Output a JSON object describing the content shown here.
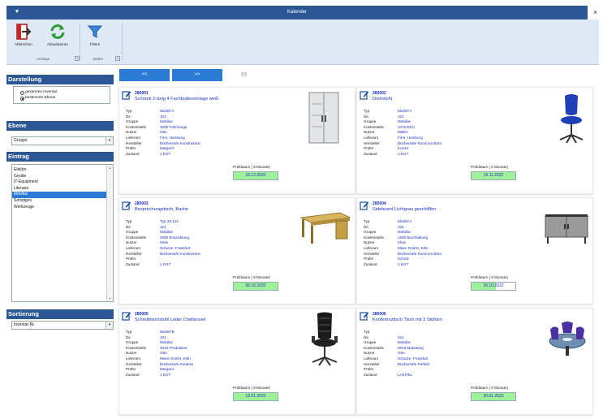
{
  "window": {
    "title": "Kalender",
    "quick_access": "⯆",
    "close": "×"
  },
  "ribbon": {
    "buttons": [
      {
        "label": "Abbrechen",
        "icon": "exit-icon"
      },
      {
        "label": "Aktualisieren",
        "icon": "refresh-icon"
      },
      {
        "label": "Filtern",
        "icon": "filter-icon"
      }
    ],
    "groups": [
      "Anzeige",
      "Daten"
    ]
  },
  "left": {
    "darstellung": {
      "title": "Darstellung",
      "options": [
        "gesamtes Inventar",
        "bestimmte Ebene"
      ],
      "selected": 1
    },
    "ebene": {
      "title": "Ebene",
      "value": "Gruppe"
    },
    "eintrag": {
      "title": "Eintrag",
      "items": [
        "Elektro",
        "Geräte",
        "IT-Equipment",
        "Literatur",
        "Mobiliar",
        "Sonstiges",
        "Werkzeuge"
      ],
      "selected": 4
    },
    "sortierung": {
      "title": "Sortierung",
      "value": "Inventar-Nr."
    }
  },
  "pager": {
    "prev": "<<",
    "next": ">>",
    "info": "1/3"
  },
  "colors": {
    "accent": "#2b5797",
    "button": "#2b7ad6",
    "link": "#1a2fbf",
    "due_fill": "#9ff09a"
  },
  "field_labels": [
    "Typ",
    "Dir.",
    "Gruppe",
    "Kostenstelle",
    "Nutzer",
    "Lieferant",
    "Hersteller",
    "Prüfer",
    "Zustand"
  ],
  "pruef_label": "Prüfdatum ( 6 Monate)",
  "cards": [
    {
      "number": "280001",
      "description": "Schrank 2-türig 4 Fachbodeneinlage weiß",
      "image": "cabinet-image",
      "values": [
        "Modell A",
        "101",
        "Mobiliar",
        "3000 Fahrzeuge",
        "Otto",
        "Firm. Hamburg",
        "Büchersafe Konstruktion",
        "Margerit",
        "1 EGT"
      ],
      "pruefdatum": "16.12.2022",
      "fill": 1.0
    },
    {
      "number": "280002",
      "description": "Drehstuhl",
      "image": "office-chair-image",
      "values": [
        "Modell A",
        "101",
        "Mobiliar",
        "1070 EDV",
        "Müller",
        "Firm. Hamburg",
        "Büchersafe Rund um Büro",
        "Kunze",
        "1 EGT"
      ],
      "pruefdatum": "16.11.2022",
      "fill": 1.0
    },
    {
      "number": "280003",
      "description": "Besprechungstisch, Buche",
      "image": "desk-image",
      "values": [
        "Typ 33-122",
        "101",
        "Mobiliar",
        "2000 Entwicklung",
        "Klein",
        "Schulze, Frankfurt",
        "Büchersafe Konstruktion",
        "",
        "1 EGT"
      ],
      "pruefdatum": "06.10.2022",
      "fill": 1.0
    },
    {
      "number": "280004",
      "description": "Sideboard Lichtgrau geschliffen",
      "image": "sideboard-image",
      "values": [
        "Modell A",
        "101",
        "Mobiliar",
        "1000 Buchhaltung",
        "Klein",
        "Meier GmbH, Köln",
        "Büchersafe Rund um Büro",
        "Scholz",
        "1 EGT"
      ],
      "pruefdatum": "26.10.2022",
      "fill": 0.55
    },
    {
      "number": "280005",
      "description": "Schreibtischstuhl Leder Chefsessel",
      "image": "executive-chair-image",
      "values": [
        "Modell B",
        "101",
        "Mobiliar",
        "2010 Produktion",
        "Otto",
        "Meier GmbH, Köln",
        "Büchersafe Kreative",
        "Margerit",
        "1 EGT"
      ],
      "pruefdatum": "13.01.2023",
      "fill": 1.0
    },
    {
      "number": "280006",
      "description": "Konferenztisch Tisch mit 3 Stühlen",
      "image": "conference-table-image",
      "values": [
        "",
        "101",
        "Mobiliar",
        "2010 Marketing",
        "Otto",
        "Schulze, Frankfurt",
        "Büchersafe Perfekt",
        "",
        "LAKITEL"
      ],
      "pruefdatum": "20.01.2023",
      "fill": 1.0
    }
  ]
}
